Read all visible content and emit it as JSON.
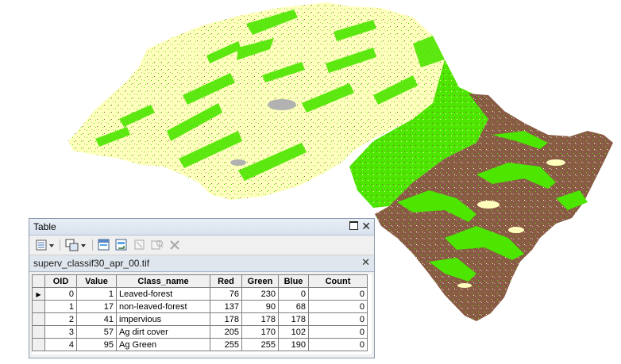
{
  "table_window": {
    "title": "Table",
    "close_glyph": "✕",
    "tab_label": "superv_classif30_apr_00.tif",
    "tab_close_glyph": "✕",
    "toolbar_icons": [
      "table-options-icon",
      "related-tables-icon",
      "select-by-attributes-icon",
      "switch-selection-icon",
      "clear-selection-icon",
      "zoom-to-selected-icon",
      "delete-selected-icon"
    ],
    "columns": [
      "OID",
      "Value",
      "Class_name",
      "Red",
      "Green",
      "Blue",
      "Count"
    ],
    "current_row_marker": "▶",
    "rows": [
      {
        "oid": "0",
        "value": "1",
        "class_name": "Leaved-forest",
        "red": "76",
        "green": "230",
        "blue": "0",
        "count": "0"
      },
      {
        "oid": "1",
        "value": "17",
        "class_name": "non-leaved-forest",
        "red": "137",
        "green": "90",
        "blue": "68",
        "count": "0"
      },
      {
        "oid": "2",
        "value": "41",
        "class_name": "impervious",
        "red": "178",
        "green": "178",
        "blue": "178",
        "count": "0"
      },
      {
        "oid": "3",
        "value": "57",
        "class_name": "Ag dirt cover",
        "red": "205",
        "green": "170",
        "blue": "102",
        "count": "0"
      },
      {
        "oid": "4",
        "value": "95",
        "class_name": "Ag Green",
        "red": "255",
        "green": "255",
        "blue": "190",
        "count": "0"
      }
    ]
  },
  "map": {
    "class_colors": {
      "leaved_forest": "#4ce600",
      "non_leaved_forest": "#895a44",
      "impervious": "#b2b2b2",
      "ag_dirt_cover": "#cdaa66",
      "ag_green": "#ffffbe"
    }
  }
}
